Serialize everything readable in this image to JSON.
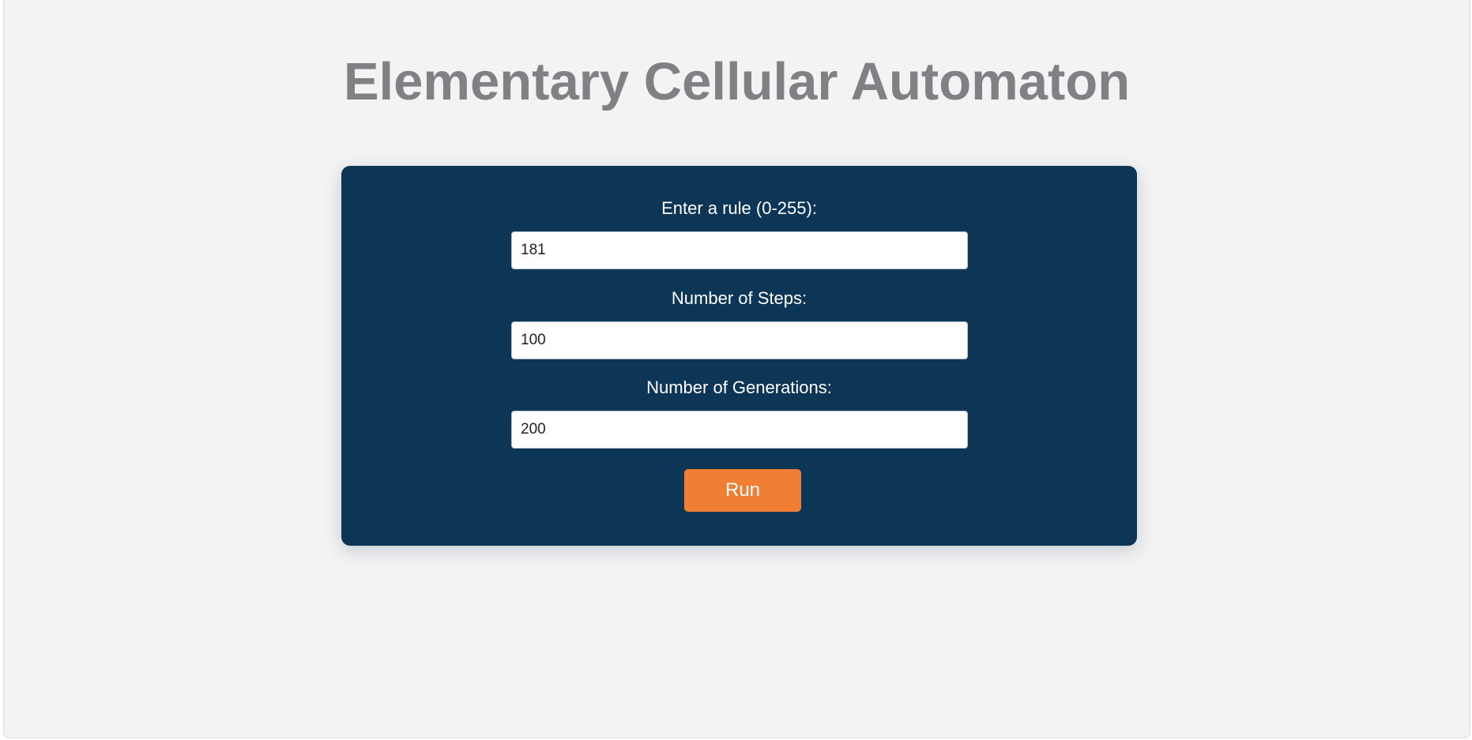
{
  "page": {
    "title": "Elementary Cellular Automaton"
  },
  "form": {
    "rule": {
      "label": "Enter a rule (0-255):",
      "value": "181"
    },
    "steps": {
      "label": "Number of Steps:",
      "value": "100"
    },
    "generations": {
      "label": "Number of Generations:",
      "value": "200"
    },
    "run_label": "Run"
  },
  "colors": {
    "background": "#f3f3f3",
    "title": "#808184",
    "panel": "#0d3555",
    "button": "#f17f33",
    "button_text": "#ffffff"
  }
}
